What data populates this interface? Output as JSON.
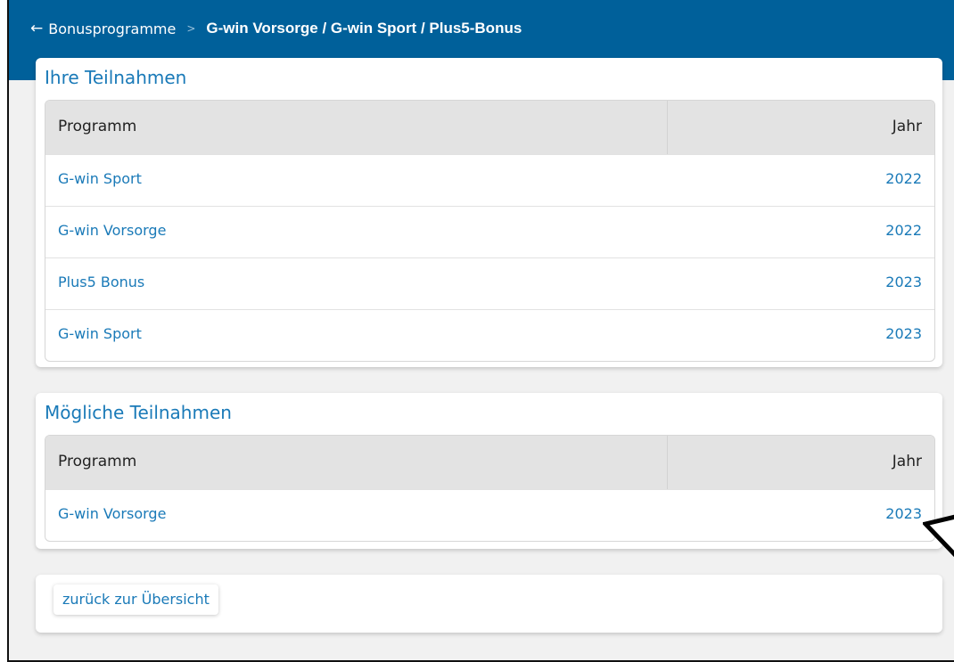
{
  "breadcrumb": {
    "parent": "Bonusprogramme",
    "separator": ">",
    "current": "G-win Vorsorge / G-win Sport / Plus5-Bonus"
  },
  "ihre_teilnahmen": {
    "title": "Ihre Teilnahmen",
    "columns": [
      "Programm",
      "Jahr"
    ],
    "rows": [
      {
        "programm": "G-win Sport",
        "jahr": "2022"
      },
      {
        "programm": "G-win Vorsorge",
        "jahr": "2022"
      },
      {
        "programm": "Plus5 Bonus",
        "jahr": "2023"
      },
      {
        "programm": "G-win Sport",
        "jahr": "2023"
      }
    ]
  },
  "moegliche_teilnahmen": {
    "title": "Mögliche Teilnahmen",
    "columns": [
      "Programm",
      "Jahr"
    ],
    "rows": [
      {
        "programm": "G-win Vorsorge",
        "jahr": "2023"
      }
    ]
  },
  "footer": {
    "back_label": "zurück zur Übersicht"
  },
  "colors": {
    "header": "#00609a",
    "link": "#1a7ab8",
    "table_header": "#e3e3e3"
  }
}
